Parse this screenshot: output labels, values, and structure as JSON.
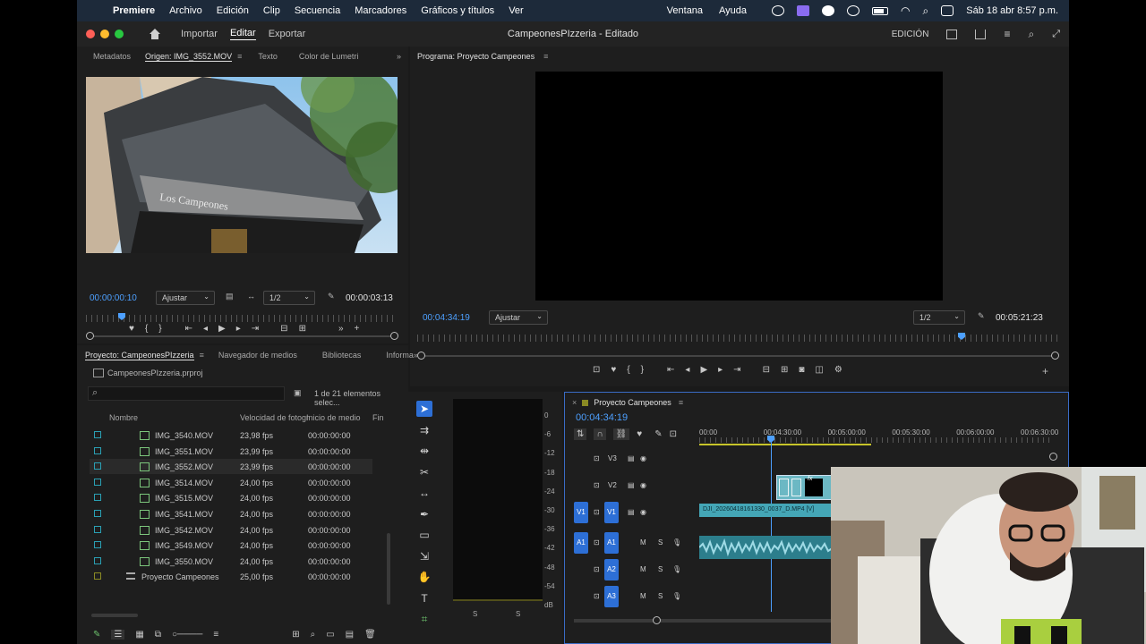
{
  "menubar": {
    "app_name": "Premiere",
    "items": [
      "Archivo",
      "Edición",
      "Clip",
      "Secuencia",
      "Marcadores",
      "Gráficos y títulos",
      "Ver",
      "Ventana",
      "Ayuda"
    ],
    "datetime": "Sáb 18 abr 8:57 p.m."
  },
  "titlebar": {
    "tabs": [
      "Importar",
      "Editar",
      "Exportar"
    ],
    "active_tab": "Editar",
    "doc_title": "CampeonesPIzzeria - Editado",
    "workspace_label": "EDICIÓN"
  },
  "source_panel": {
    "tabs": [
      "Metadatos",
      "Origen: IMG_3552.MOV",
      "Texto",
      "Color de Lumetri"
    ],
    "active_tab": "Origen: IMG_3552.MOV",
    "video_sign_text": "Los Campeones",
    "timecode_current": "00:00:00:10",
    "fit_label": "Ajustar",
    "resolution": "1/2",
    "timecode_duration": "00:00:03:13"
  },
  "program_panel": {
    "tab": "Programa: Proyecto Campeones",
    "timecode_current": "00:04:34:19",
    "fit_label": "Ajustar",
    "resolution": "1/2",
    "timecode_duration": "00:05:21:23"
  },
  "project_panel": {
    "tabs": [
      "Proyecto: CampeonesPIzzeria",
      "Navegador de medios",
      "Bibliotecas",
      "Informa"
    ],
    "project_file": "CampeonesPIzzeria.prproj",
    "selection_status": "1 de 21 elementos selec...",
    "columns": [
      "Nombre",
      "Velocidad de fotogr",
      "Inicio de medio",
      "Fin"
    ],
    "rows": [
      {
        "name": "IMG_3540.MOV",
        "fps": "23,98 fps",
        "start": "00:00:00:00",
        "color": "#2aa0b4",
        "type": "clip"
      },
      {
        "name": "IMG_3551.MOV",
        "fps": "23,99 fps",
        "start": "00:00:00:00",
        "color": "#2aa0b4",
        "type": "clip"
      },
      {
        "name": "IMG_3552.MOV",
        "fps": "23,99 fps",
        "start": "00:00:00:00",
        "color": "#2aa0b4",
        "type": "clip",
        "selected": true
      },
      {
        "name": "IMG_3514.MOV",
        "fps": "24,00 fps",
        "start": "00:00:00:00",
        "color": "#2aa0b4",
        "type": "clip"
      },
      {
        "name": "IMG_3515.MOV",
        "fps": "24,00 fps",
        "start": "00:00:00:00",
        "color": "#2aa0b4",
        "type": "clip"
      },
      {
        "name": "IMG_3541.MOV",
        "fps": "24,00 fps",
        "start": "00:00:00:00",
        "color": "#2aa0b4",
        "type": "clip"
      },
      {
        "name": "IMG_3542.MOV",
        "fps": "24,00 fps",
        "start": "00:00:00:00",
        "color": "#2aa0b4",
        "type": "clip"
      },
      {
        "name": "IMG_3549.MOV",
        "fps": "24,00 fps",
        "start": "00:00:00:00",
        "color": "#2aa0b4",
        "type": "clip"
      },
      {
        "name": "IMG_3550.MOV",
        "fps": "24,00 fps",
        "start": "00:00:00:00",
        "color": "#2aa0b4",
        "type": "clip"
      },
      {
        "name": "Proyecto Campeones",
        "fps": "25,00 fps",
        "start": "00:00:00:00",
        "color": "#8a8a24",
        "type": "sequence"
      }
    ]
  },
  "audio_meter": {
    "scale": [
      "0",
      "-6",
      "-12",
      "-18",
      "-24",
      "-30",
      "-36",
      "-42",
      "-48",
      "-54",
      "dB"
    ],
    "channel_labels": [
      "S",
      "S"
    ]
  },
  "timeline": {
    "tab": "Proyecto Campeones",
    "timecode": "00:04:34:19",
    "ruler_labels": [
      "00:00",
      "00:04:30:00",
      "00:05:00:00",
      "00:05:30:00",
      "00:06:00:00",
      "00:06:30:00"
    ],
    "video_tracks": [
      {
        "source": "",
        "target": "V3"
      },
      {
        "source": "",
        "target": "V2"
      },
      {
        "source": "V1",
        "target": "V1"
      }
    ],
    "audio_tracks": [
      {
        "source": "A1",
        "target": "A1"
      },
      {
        "source": "",
        "target": "A2"
      },
      {
        "source": "",
        "target": "A3"
      }
    ],
    "mute_label": "M",
    "solo_label": "S",
    "v1_clip_name": "DJI_20260418161330_0037_D.MP4 [V]",
    "fx_label": "fx"
  },
  "colors": {
    "accent_blue": "#2d6fd6",
    "timecode_blue": "#4da0ff",
    "clip_teal": "#44a6b6",
    "audio_teal": "#2c7e8c"
  }
}
